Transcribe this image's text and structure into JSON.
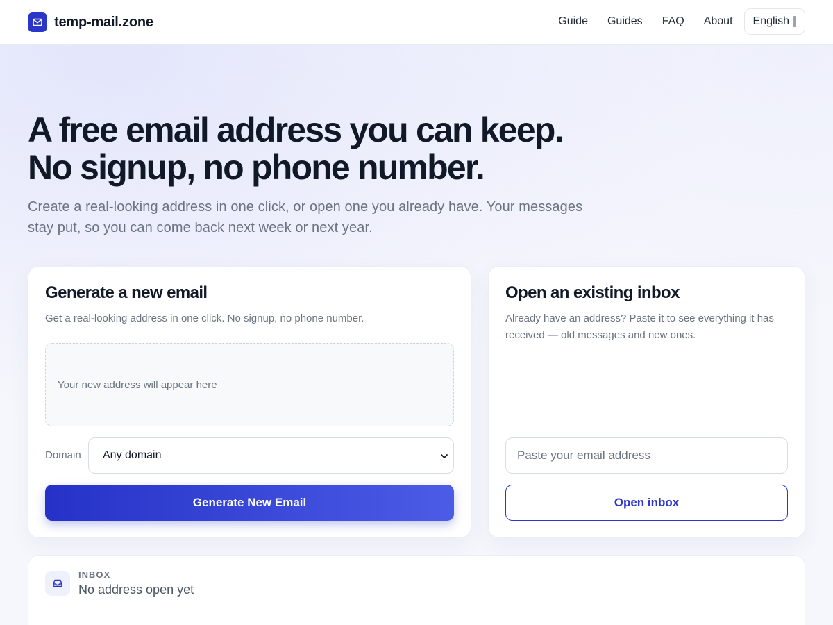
{
  "header": {
    "brand": "temp-mail.zone",
    "nav": [
      "Guide",
      "Guides",
      "FAQ",
      "About"
    ],
    "language": "English"
  },
  "hero": {
    "title_line1": "A free email address you can keep.",
    "title_line2": "No signup, no phone number.",
    "subtitle": "Create a real-looking address in one click, or open one you already have. Your messages stay put, so you can come back next week or next year."
  },
  "generate": {
    "title": "Generate a new email",
    "description": "Get a real-looking address in one click. No signup, no phone number.",
    "placeholder": "Your new address will appear here",
    "domain_label": "Domain",
    "domain_value": "Any domain",
    "button": "Generate New Email"
  },
  "open": {
    "title": "Open an existing inbox",
    "description": "Already have an address? Paste it to see everything it has received — old messages and new ones.",
    "input_placeholder": "Paste your email address",
    "button": "Open inbox"
  },
  "inbox": {
    "eyebrow": "INBOX",
    "status": "No address open yet"
  },
  "colors": {
    "accent": "#2a35c9",
    "accent_light": "#4b5ce6",
    "text_primary": "#111827",
    "text_muted": "#6b7280"
  },
  "icons": {
    "logo": "mail-icon",
    "inbox": "inbox-icon",
    "select": "chevron-down-icon"
  }
}
